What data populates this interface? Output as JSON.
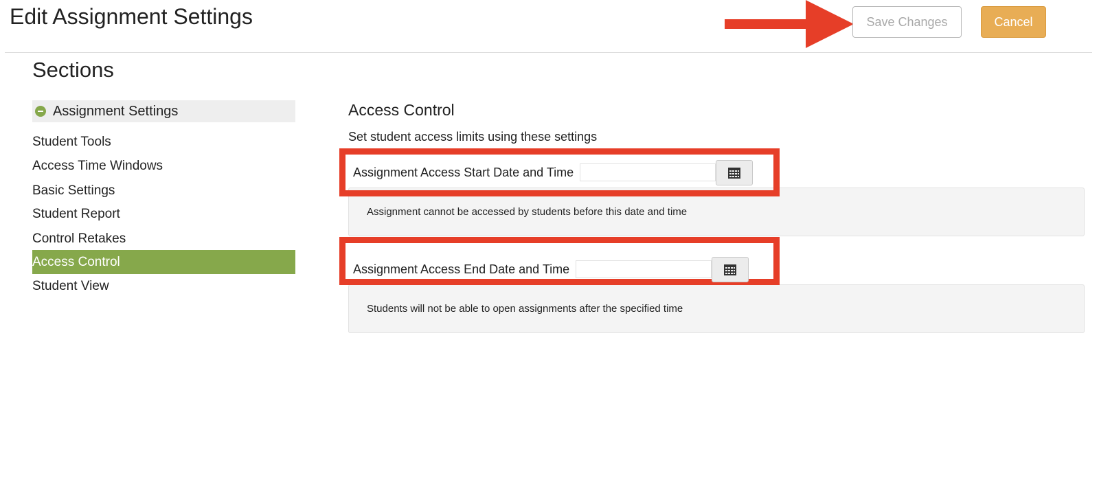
{
  "header": {
    "title": "Edit Assignment Settings",
    "save_label": "Save Changes",
    "cancel_label": "Cancel"
  },
  "sidebar": {
    "title": "Sections",
    "group_label": "Assignment Settings",
    "group_icon": "minus-circle-icon",
    "items": [
      {
        "label": "Student Tools"
      },
      {
        "label": "Access Time Windows"
      },
      {
        "label": "Basic Settings"
      },
      {
        "label": "Student Report"
      },
      {
        "label": "Control Retakes"
      },
      {
        "label": "Access Control"
      },
      {
        "label": "Student View"
      }
    ],
    "active_item": "Access Control"
  },
  "main": {
    "heading": "Access Control",
    "description": "Set student access limits using these settings",
    "fields": [
      {
        "label": "Assignment Access Start Date and Time",
        "value": "",
        "calendar_icon": "calendar-icon",
        "help": "Assignment cannot be accessed by students before this date and time"
      },
      {
        "label": "Assignment Access End Date and Time",
        "value": "",
        "calendar_icon": "calendar-icon",
        "help": "Students will not be able to open assignments after the specified time"
      }
    ]
  },
  "colors": {
    "accent_green": "#86a84b",
    "cancel_orange": "#e8ad55",
    "annotation_red": "#e63e28"
  }
}
